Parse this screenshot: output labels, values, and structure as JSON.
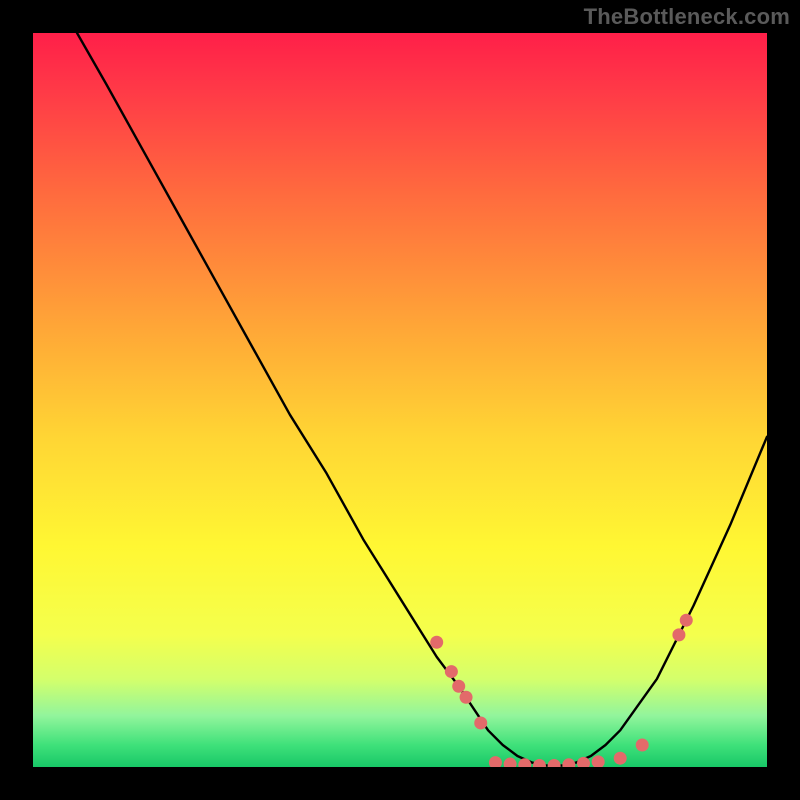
{
  "watermark": "TheBottleneck.com",
  "chart_data": {
    "type": "line",
    "title": "",
    "xlabel": "",
    "ylabel": "",
    "xlim": [
      0,
      100
    ],
    "ylim": [
      0,
      100
    ],
    "series": [
      {
        "name": "bottleneck-curve",
        "x": [
          6,
          10,
          15,
          20,
          25,
          30,
          35,
          40,
          45,
          50,
          55,
          58,
          60,
          62,
          64,
          66,
          68,
          70,
          72,
          74,
          76,
          78,
          80,
          85,
          90,
          95,
          100
        ],
        "y": [
          100,
          93,
          84,
          75,
          66,
          57,
          48,
          40,
          31,
          23,
          15,
          11,
          8,
          5,
          3,
          1.5,
          0.6,
          0.2,
          0.2,
          0.6,
          1.5,
          3,
          5,
          12,
          22,
          33,
          45
        ]
      }
    ],
    "markers": {
      "name": "highlight-points",
      "color": "#e36a6a",
      "points": [
        {
          "x": 55,
          "y": 17
        },
        {
          "x": 57,
          "y": 13
        },
        {
          "x": 58,
          "y": 11
        },
        {
          "x": 59,
          "y": 9.5
        },
        {
          "x": 61,
          "y": 6
        },
        {
          "x": 63,
          "y": 0.6
        },
        {
          "x": 65,
          "y": 0.4
        },
        {
          "x": 67,
          "y": 0.3
        },
        {
          "x": 69,
          "y": 0.2
        },
        {
          "x": 71,
          "y": 0.2
        },
        {
          "x": 73,
          "y": 0.3
        },
        {
          "x": 75,
          "y": 0.5
        },
        {
          "x": 77,
          "y": 0.7
        },
        {
          "x": 80,
          "y": 1.2
        },
        {
          "x": 83,
          "y": 3
        },
        {
          "x": 88,
          "y": 18
        },
        {
          "x": 89,
          "y": 20
        }
      ]
    }
  }
}
